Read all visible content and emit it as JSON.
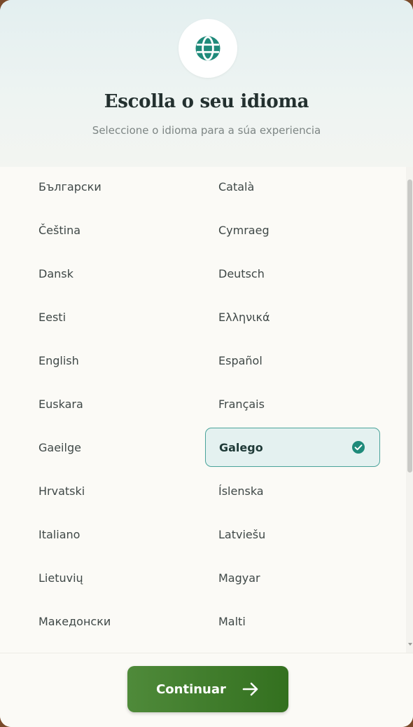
{
  "dialog": {
    "title": "Escolla o seu idioma",
    "subtitle": "Seleccione o idioma para a súa experiencia",
    "icon": "globe-icon",
    "accent_color": "#1f8a7a"
  },
  "languages": {
    "left": [
      "Български",
      "Čeština",
      "Dansk",
      "Eesti",
      "English",
      "Euskara",
      "Gaeilge",
      "Hrvatski",
      "Italiano",
      "Lietuvių",
      "Македонски"
    ],
    "right": [
      "Català",
      "Cymraeg",
      "Deutsch",
      "Ελληνικά",
      "Español",
      "Français",
      "Galego",
      "Íslenska",
      "Latviešu",
      "Magyar",
      "Malti"
    ]
  },
  "selected_language": "Galego",
  "footer": {
    "continue_label": "Continuar",
    "continue_icon": "arrow-right-icon",
    "button_color": "#3f7d2c"
  }
}
